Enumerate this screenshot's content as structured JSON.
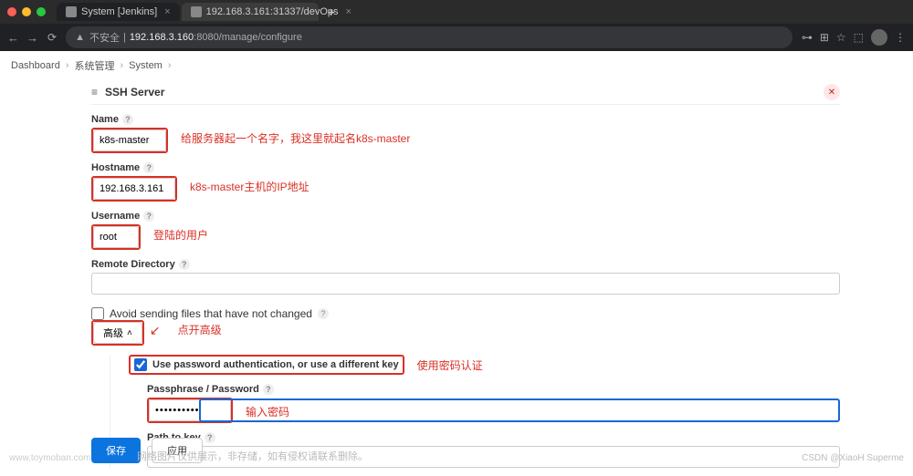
{
  "browser": {
    "tabs": [
      {
        "title": "System [Jenkins]",
        "active": true
      },
      {
        "title": "192.168.3.161:31337/devOps",
        "active": false
      }
    ],
    "url_insecure_label": "不安全",
    "url_host": "192.168.3.160",
    "url_port_path": ":8080/manage/configure"
  },
  "breadcrumbs": [
    "Dashboard",
    "系统管理",
    "System"
  ],
  "section": {
    "title": "SSH Server"
  },
  "fields": {
    "name": {
      "label": "Name",
      "value": "k8s-master"
    },
    "host": {
      "label": "Hostname",
      "value": "192.168.3.161"
    },
    "user": {
      "label": "Username",
      "value": "root"
    },
    "remote": {
      "label": "Remote Directory",
      "value": ""
    },
    "avoid": {
      "label": "Avoid sending files that have not changed",
      "checked": false
    },
    "advanced_btn": "高级",
    "use_pw": {
      "label": "Use password authentication, or use a different key",
      "checked": true
    },
    "pass": {
      "label": "Passphrase / Password",
      "value": "••••••••••"
    },
    "pathkey": {
      "label": "Path to key",
      "value": ""
    }
  },
  "annotations": {
    "name": "给服务器起一个名字，我这里就起名k8s-master",
    "host": "k8s-master主机的IP地址",
    "user": "登陆的用户",
    "adv": "点开高级",
    "usepw": "使用密码认证",
    "pass": "输入密码"
  },
  "buttons": {
    "save": "保存",
    "apply": "应用"
  },
  "footer": {
    "watermark_left": "www.toymoban.com",
    "disclaimer": "网络图片仅供展示，非存储，如有侵权请联系删除。",
    "copyright": "CSDN @XiaoH Superme"
  }
}
